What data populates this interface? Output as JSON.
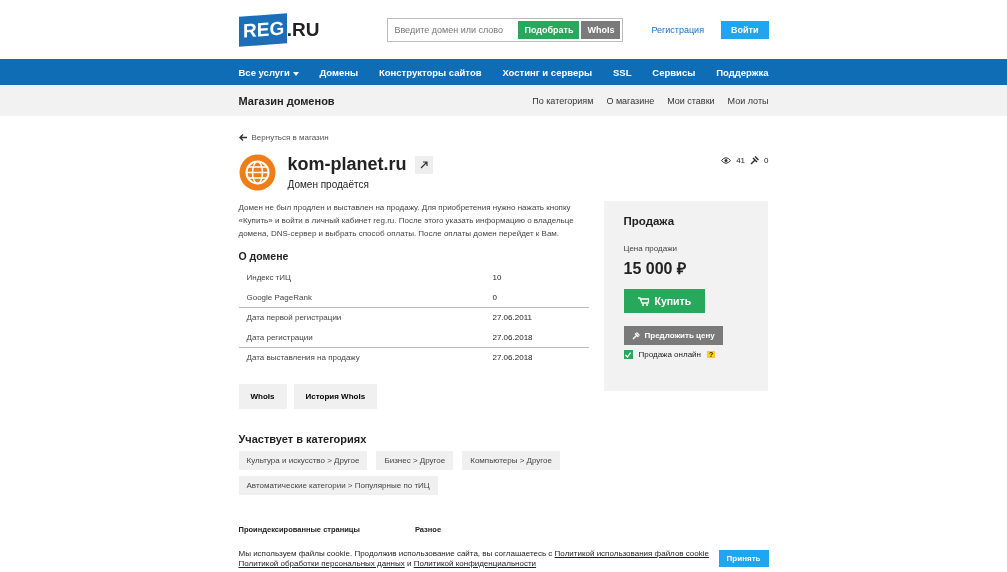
{
  "header": {
    "logo": "REG",
    "logo_suffix": ".RU",
    "search": {
      "placeholder": "Введите домен или слово",
      "pick_button": "Подобрать",
      "whois_button": "WhoIs"
    },
    "register_link": "Регистрация",
    "login_button": "Войти"
  },
  "nav": [
    {
      "label": "Все услуги",
      "dropdown": true
    },
    {
      "label": "Домены",
      "dropdown": false
    },
    {
      "label": "Конструкторы сайтов",
      "dropdown": false
    },
    {
      "label": "Хостинг и серверы",
      "dropdown": false
    },
    {
      "label": "SSL",
      "dropdown": false
    },
    {
      "label": "Сервисы",
      "dropdown": false
    },
    {
      "label": "Поддержка",
      "dropdown": false
    }
  ],
  "subnav": {
    "title": "Магазин доменов",
    "links": [
      "По категориям",
      "О магазине",
      "Мои ставки",
      "Мои лоты"
    ]
  },
  "back_link": "Вернуться в магазин",
  "domain": {
    "name": "kom-planet.ru",
    "status": "Домен продаётся",
    "views": "41",
    "bids": "0"
  },
  "description": "Домен не был продлен и выставлен на продажу. Для приобретения нужно нажать кнопку «Купить» и войти в личный кабинет reg.ru. После этого указать информацию о владельце домена, DNS-сервер и выбрать способ оплаты. После оплаты домен перейдет к Вам.",
  "about": {
    "title": "О домене",
    "groups": [
      [
        {
          "label": "Индекс тИЦ",
          "value": "10"
        },
        {
          "label": "Google PageRank",
          "value": "0"
        }
      ],
      [
        {
          "label": "Дата первой регистрации",
          "value": "27.06.2011"
        },
        {
          "label": "Дата регистрации",
          "value": "27.06.2018"
        }
      ],
      [
        {
          "label": "Дата выставления на продажу",
          "value": "27.06.2018"
        }
      ]
    ]
  },
  "actions": [
    "WhoIs",
    "История WhoIs"
  ],
  "sale": {
    "title": "Продажа",
    "price_label": "Цена продажи",
    "price": "15 000 ₽",
    "buy_button": "Купить",
    "offer_button": "Предложить цену",
    "online": {
      "label": "Продажа онлайн",
      "checked": true
    },
    "help": "?"
  },
  "categories": {
    "title": "Участвует в категориях",
    "items": [
      "Культура и искусство > Другое",
      "Бизнес > Другое",
      "Компьютеры > Другое",
      "Автоматические категории > Популярные по тИЦ"
    ]
  },
  "footer": [
    "Проиндексированные страницы",
    "Разное"
  ],
  "cookie": {
    "parts": [
      {
        "text": "Мы используем файлы cookie. Продолжив использование сайта, вы соглашаетесь с",
        "kind": "text"
      },
      {
        "text": "Политикой использования файлов cookie",
        "kind": "link"
      },
      {
        "text": "Политикой обработки персональных данных",
        "kind": "link"
      },
      {
        "text": "и",
        "kind": "text"
      },
      {
        "text": "Политикой конфиденциальности",
        "kind": "link"
      }
    ],
    "accept_button": "Принять"
  }
}
